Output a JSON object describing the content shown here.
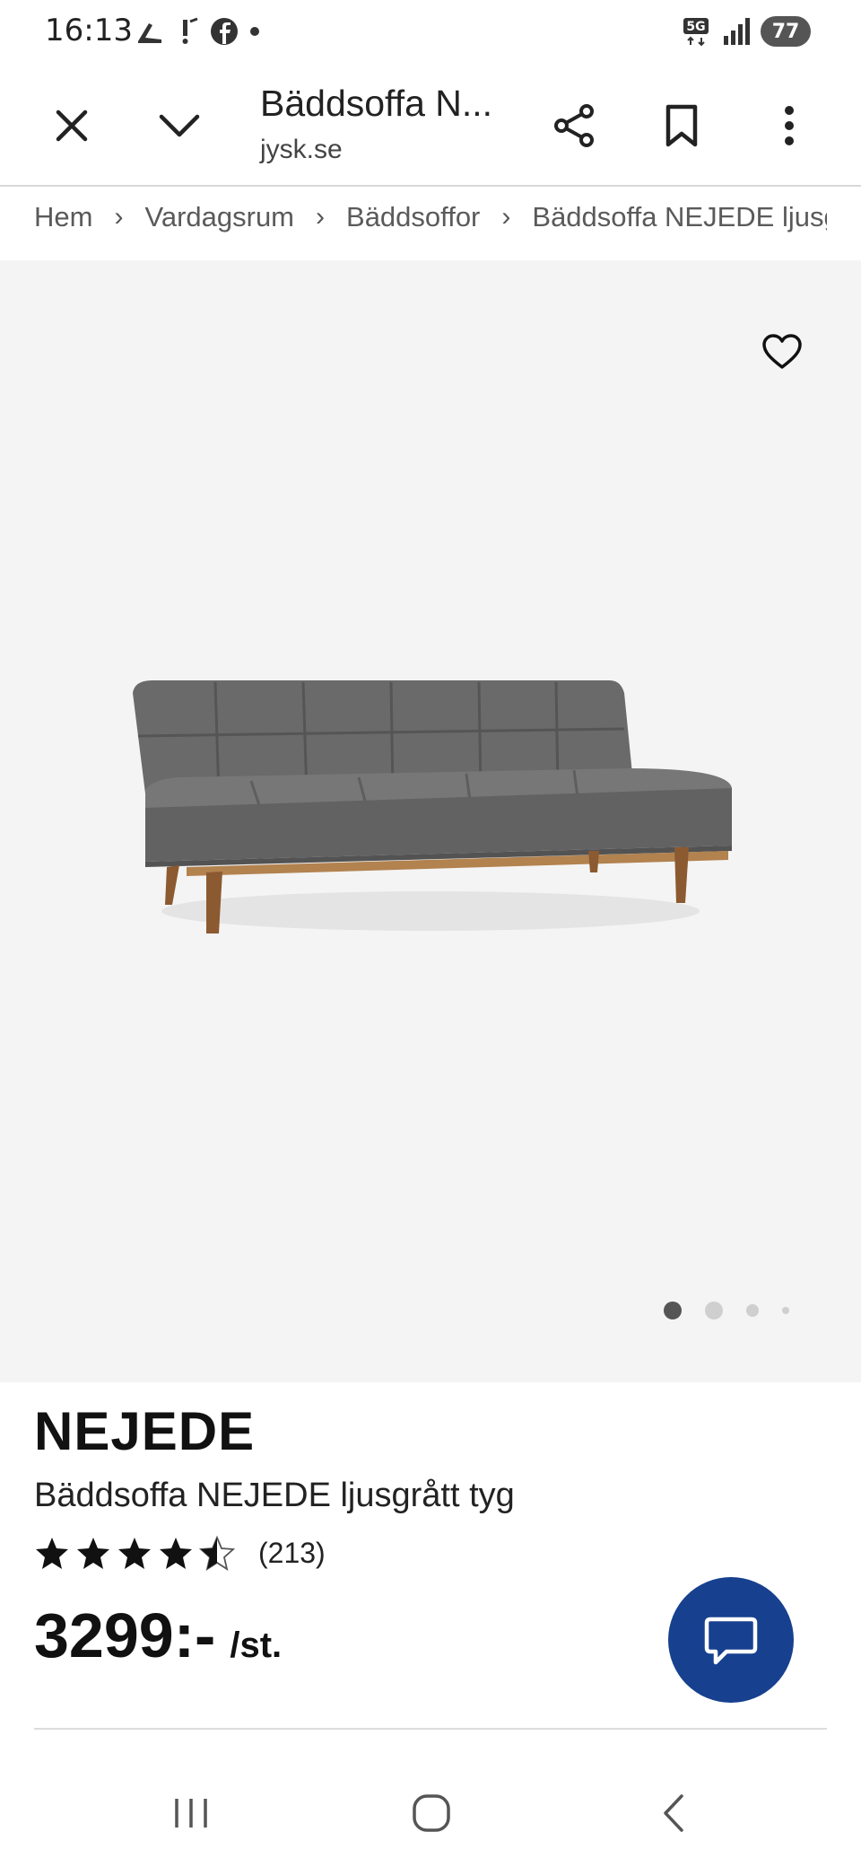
{
  "status_bar": {
    "time": "16:13",
    "network": "5G",
    "battery": "77"
  },
  "browser": {
    "page_title": "Bäddsoffa N...",
    "domain": "jysk.se"
  },
  "breadcrumb": [
    "Hem",
    "Vardagsrum",
    "Bäddsoffor",
    "Bäddsoffa NEJEDE ljusg"
  ],
  "carousel": {
    "image_count": 4,
    "active_index": 0
  },
  "product": {
    "brand": "NEJEDE",
    "name": "Bäddsoffa NEJEDE ljusgrått tyg",
    "rating": 4.5,
    "review_count": "(213)",
    "price": "3299:-",
    "unit": "/st."
  },
  "colors": {
    "accent": "#17408f",
    "hero_background": "#f4f4f4"
  }
}
